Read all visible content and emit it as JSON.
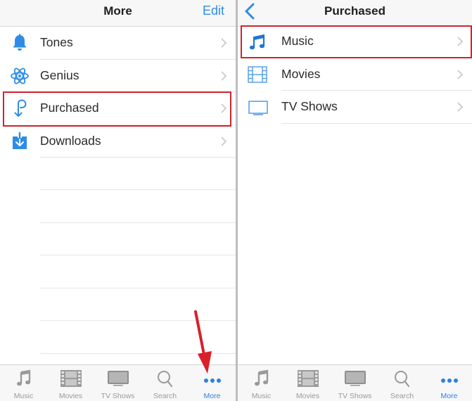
{
  "left_screen": {
    "navbar": {
      "title": "More",
      "edit_label": "Edit"
    },
    "items": [
      {
        "label": "Tones",
        "icon": "bell-icon"
      },
      {
        "label": "Genius",
        "icon": "atom-icon"
      },
      {
        "label": "Purchased",
        "icon": "purchased-icon",
        "highlighted": true
      },
      {
        "label": "Downloads",
        "icon": "download-icon"
      }
    ],
    "tabbar": [
      {
        "label": "Music",
        "icon": "music-note-icon",
        "active": false
      },
      {
        "label": "Movies",
        "icon": "film-icon",
        "active": false
      },
      {
        "label": "TV Shows",
        "icon": "tv-icon",
        "active": false
      },
      {
        "label": "Search",
        "icon": "search-icon",
        "active": false
      },
      {
        "label": "More",
        "icon": "more-dots-icon",
        "active": true
      }
    ]
  },
  "right_screen": {
    "navbar": {
      "title": "Purchased",
      "back_icon": "chevron-left-icon"
    },
    "items": [
      {
        "label": "Music",
        "icon": "music-note-icon",
        "highlighted": true
      },
      {
        "label": "Movies",
        "icon": "film-icon"
      },
      {
        "label": "TV Shows",
        "icon": "tv-icon"
      }
    ],
    "tabbar": [
      {
        "label": "Music",
        "icon": "music-note-icon",
        "active": false
      },
      {
        "label": "Movies",
        "icon": "film-icon",
        "active": false
      },
      {
        "label": "TV Shows",
        "icon": "tv-icon",
        "active": false
      },
      {
        "label": "Search",
        "icon": "search-icon",
        "active": false
      },
      {
        "label": "More",
        "icon": "more-dots-icon",
        "active": true
      }
    ]
  },
  "colors": {
    "accent": "#2e8ce6",
    "highlight_box": "#cf2430",
    "annotation_arrow": "#d8202a",
    "tab_inactive": "#9a9a9a"
  }
}
